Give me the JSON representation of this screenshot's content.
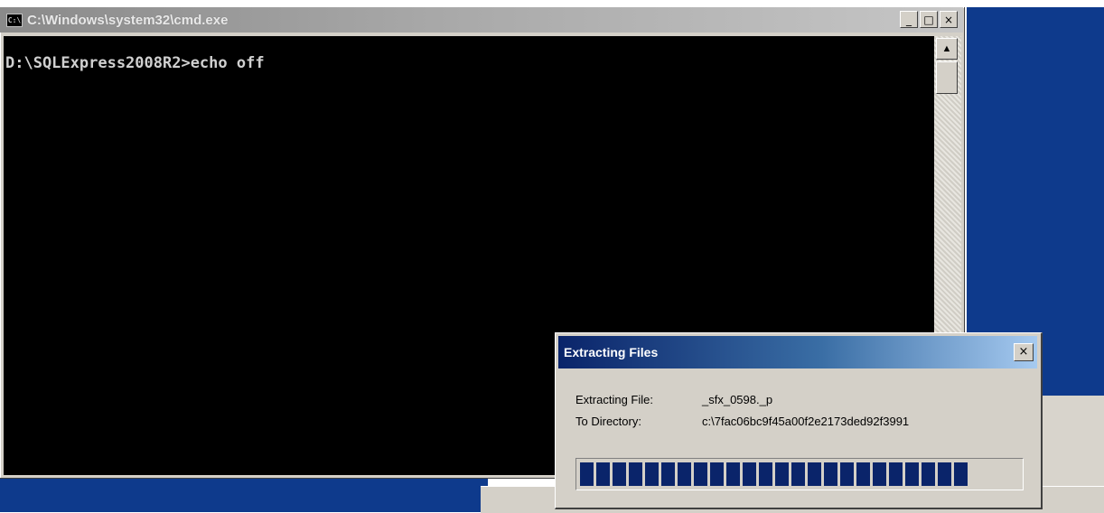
{
  "cmd_window": {
    "title": "C:\\Windows\\system32\\cmd.exe",
    "icon": "cmd-icon",
    "icon_text": "C:\\",
    "controls": {
      "minimize": "_",
      "maximize": "□",
      "close": "×"
    },
    "console_line": "D:\\SQLExpress2008R2>echo off"
  },
  "dialog": {
    "title": "Extracting Files",
    "close_label": "×",
    "extracting_label": "Extracting File:",
    "extracting_value": "_sfx_0598._p",
    "directory_label": "To Directory:",
    "directory_value": "c:\\7fac06bc9f45a00f2e2173ded92f3991",
    "progress_fraction": 0.89,
    "progress_color": "#0a246a"
  },
  "colors": {
    "desktop": "#0e3a8c",
    "console_bg": "#000000",
    "console_text": "#d0d0d0"
  }
}
